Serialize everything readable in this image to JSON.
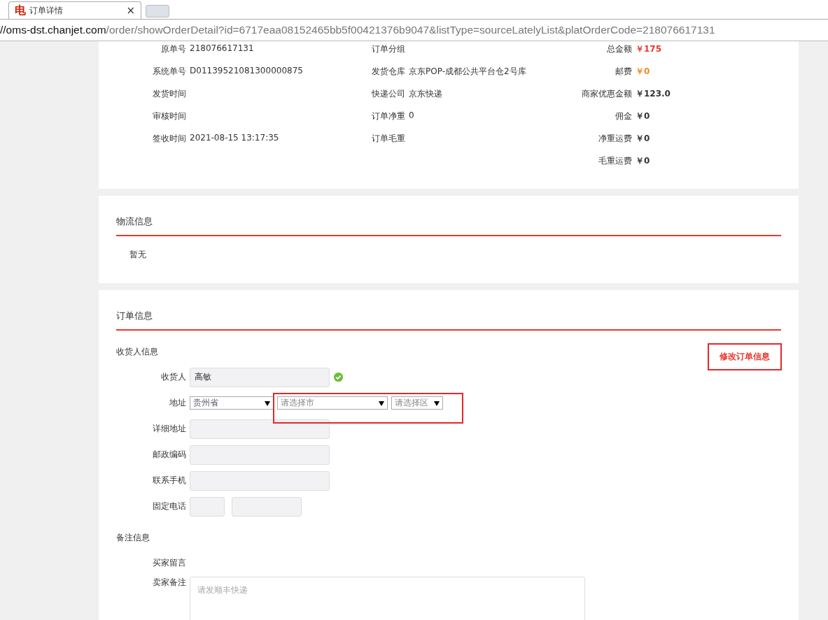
{
  "browser": {
    "tab": {
      "logo": "电",
      "title": "订单详情",
      "close": "×"
    },
    "url": {
      "host": "//oms-dst.chanjet.com",
      "path": "/order/showOrderDetail?id=6717eaa08152465bb5f00421376b9047&listType=sourceLatelyList&platOrderCode=218076617131"
    }
  },
  "summary": {
    "columns": [
      [
        {
          "label": "原单号",
          "value": "218076617131"
        },
        {
          "label": "系统单号",
          "value": "D01139521081300000875"
        },
        {
          "label": "发货时间"
        },
        {
          "label": "审核时间"
        },
        {
          "label": "签收时间",
          "value": "2021-08-15 13:17:35"
        }
      ],
      [
        {
          "label": "订单分组"
        },
        {
          "label": "发货仓库",
          "value": "京东POP-成都公共平台仓2号库"
        },
        {
          "label": "快递公司",
          "value": "京东快递"
        },
        {
          "label": "订单净重",
          "value": "0"
        },
        {
          "label": "订单毛重"
        }
      ],
      [
        {
          "label": "总金额",
          "value": "￥175",
          "color": "#e8382f"
        },
        {
          "label": "邮费",
          "value": "￥0",
          "color": "#f08a24"
        },
        {
          "label": "商家优惠金额",
          "value": "￥123.0",
          "color": "#333333"
        },
        {
          "label": "佣金",
          "value": "￥0",
          "color": "#333333"
        },
        {
          "label": "净重运费",
          "value": "￥0",
          "color": "#333333"
        },
        {
          "label": "毛重运费",
          "value": "￥0",
          "color": "#333333"
        }
      ]
    ]
  },
  "logistics": {
    "title": "物流信息",
    "text": "暂无"
  },
  "order_info": {
    "title": "订单信息",
    "edit_button": {
      "label": "修改订单信息",
      "highlighted": true
    },
    "receiver": {
      "title": "收货人信息",
      "fields": [
        {
          "kind": "text",
          "label": "收货人",
          "value": "高敏",
          "verified": true
        },
        {
          "kind": "address",
          "label": "地址",
          "highlighted": true,
          "selects": [
            {
              "value": "贵州省"
            },
            {
              "placeholder": "请选择市"
            },
            {
              "placeholder": "请选择区"
            }
          ]
        },
        {
          "kind": "text",
          "label": "详细地址"
        },
        {
          "kind": "text",
          "label": "邮政编码"
        },
        {
          "kind": "text",
          "label": "联系手机"
        },
        {
          "kind": "phone",
          "label": "固定电话"
        }
      ]
    },
    "remarks": {
      "title": "备注信息",
      "buyer_label": "买家留言",
      "seller_label": "卖家备注",
      "seller_placeholder": "请发顺丰快递"
    }
  }
}
